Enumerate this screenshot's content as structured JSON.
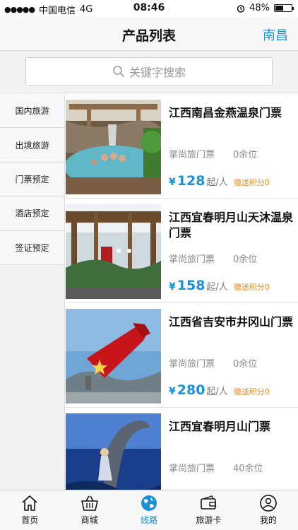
{
  "status_bar": {
    "signal": "●●●●●",
    "carrier": "中国电信",
    "network": "4G",
    "time": "08:46",
    "alarm_icon": "alarm-clock-icon",
    "battery_text": "48%",
    "battery_level": 0.48
  },
  "nav": {
    "title": "产品列表",
    "city": "南昌"
  },
  "search": {
    "icon": "search-icon",
    "placeholder": "关键字搜索"
  },
  "sidebar": {
    "items": [
      {
        "label": "国内旅游"
      },
      {
        "label": "出境旅游"
      },
      {
        "label": "门票预定"
      },
      {
        "label": "酒店预定"
      },
      {
        "label": "签证预定"
      }
    ]
  },
  "products": [
    {
      "title": "江西南昌金燕温泉门票",
      "agency": "掌尚旅门票",
      "remaining": "0余位",
      "currency": "¥",
      "price": "128",
      "unit": "起/人",
      "bonus": "赠送积分0"
    },
    {
      "title": "江西宜春明月山天沐温泉门票",
      "agency": "掌尚旅门票",
      "remaining": "0余位",
      "currency": "¥",
      "price": "158",
      "unit": "起/人",
      "bonus": "赠送积分0"
    },
    {
      "title": "江西省吉安市井冈山门票",
      "agency": "掌尚旅门票",
      "remaining": "0余位",
      "currency": "¥",
      "price": "280",
      "unit": "起/人",
      "bonus": "赠送积分0"
    },
    {
      "title": "江西宜春明月山门票",
      "agency": "掌尚旅门票",
      "remaining": "40余位"
    }
  ],
  "tabs": [
    {
      "label": "首页",
      "icon": "home-icon"
    },
    {
      "label": "商城",
      "icon": "shopping-basket-icon"
    },
    {
      "label": "线路",
      "icon": "globe-icon"
    },
    {
      "label": "旅游卡",
      "icon": "wallet-card-icon"
    },
    {
      "label": "我的",
      "icon": "user-icon"
    }
  ],
  "colors": {
    "accent": "#1e90d8",
    "bonus": "#f28a1b"
  }
}
